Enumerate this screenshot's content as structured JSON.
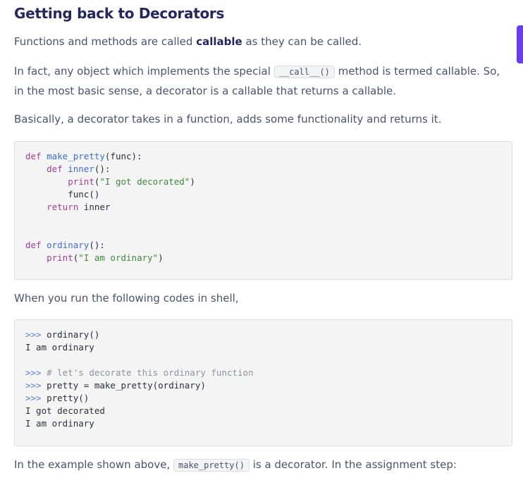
{
  "heading": "Getting back to Decorators",
  "p1": {
    "before": "Functions and methods are called ",
    "bold": "callable",
    "after": " as they can be called."
  },
  "p2": {
    "before": "In fact, any object which implements the special ",
    "code": "__call__()",
    "after": " method is termed callable. So, in the most basic sense, a decorator is a callable that returns a callable."
  },
  "p3": "Basically, a decorator takes in a function, adds some functionality and returns it.",
  "code1": {
    "kw_def": "def",
    "make_pretty": "make_pretty",
    "make_pretty_args": "(func):",
    "inner": "inner",
    "inner_args": "():",
    "print": "print",
    "str_decorated": "\"I got decorated\"",
    "func_call": "func()",
    "kw_return": "return",
    "return_val": "inner",
    "ordinary": "ordinary",
    "ordinary_args": "():",
    "str_ordinary": "\"I am ordinary\""
  },
  "p4": "When you run the following codes in shell,",
  "code2": {
    "prompt": ">>>",
    "cmd1": "ordinary()",
    "out1": "I am ordinary",
    "comment": "# let's decorate this ordinary function",
    "cmd2": "pretty = make_pretty(ordinary)",
    "cmd3": "pretty()",
    "out2": "I got decorated",
    "out3": "I am ordinary"
  },
  "p5": {
    "before": "In the example shown above, ",
    "code": "make_pretty()",
    "after": " is a decorator. In the assignment step:"
  },
  "colors": {
    "heading": "#25265e",
    "body_text": "#4a5270",
    "keyword": "#a03e8e",
    "function": "#3f6ec6",
    "string": "#3c8a3c",
    "accent": "#6a3cf0"
  }
}
